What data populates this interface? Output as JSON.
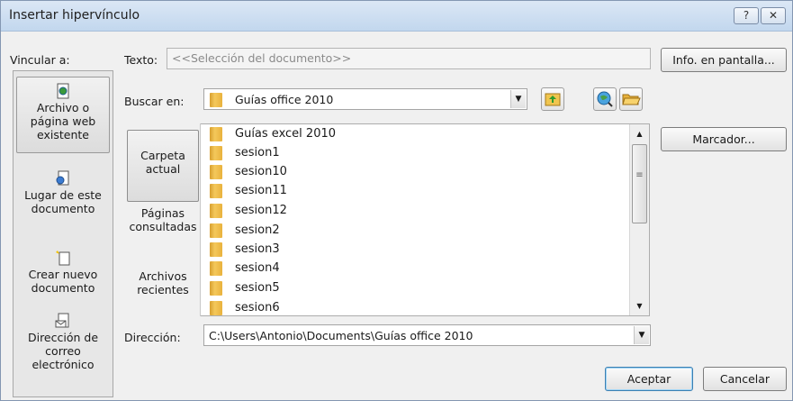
{
  "window": {
    "title": "Insertar hipervínculo",
    "help": "?",
    "close": "✕"
  },
  "link_to": {
    "label": "Vincular a:",
    "items": [
      {
        "line1": "Archivo o",
        "line2": "página web",
        "line3": "existente",
        "icon": "web-page-icon"
      },
      {
        "line1": "Lugar de este",
        "line2": "documento",
        "line3": "",
        "icon": "place-in-doc-icon"
      },
      {
        "line1": "Crear nuevo",
        "line2": "documento",
        "line3": "",
        "icon": "new-doc-icon"
      },
      {
        "line1": "Dirección de",
        "line2": "correo",
        "line3": "electrónico",
        "icon": "email-icon"
      }
    ]
  },
  "texto": {
    "label": "Texto:",
    "value": "<<Selección del documento>>"
  },
  "buttons": {
    "info": "Info. en pantalla...",
    "marcador": "Marcador...",
    "aceptar": "Aceptar",
    "cancelar": "Cancelar"
  },
  "buscar": {
    "label": "Buscar en:",
    "value": "Guías office 2010"
  },
  "places": [
    {
      "line1": "Carpeta",
      "line2": "actual"
    },
    {
      "line1": "Páginas",
      "line2": "consultadas"
    },
    {
      "line1": "Archivos",
      "line2": "recientes"
    }
  ],
  "files": [
    "Guías excel 2010",
    "sesion1",
    "sesion10",
    "sesion11",
    "sesion12",
    "sesion2",
    "sesion3",
    "sesion4",
    "sesion5",
    "sesion6"
  ],
  "direccion": {
    "label": "Dirección:",
    "value": "C:\\Users\\Antonio\\Documents\\Guías office 2010"
  }
}
